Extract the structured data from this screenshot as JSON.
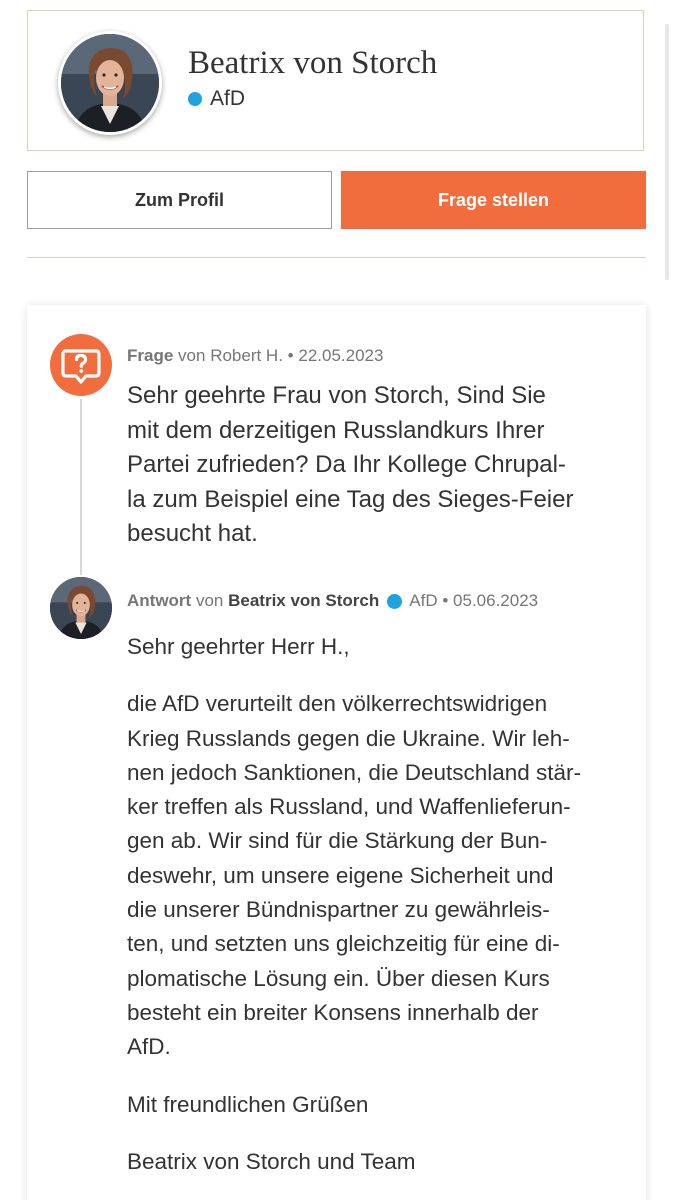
{
  "profile": {
    "name": "Beatrix von Storch",
    "party": "AfD"
  },
  "buttons": {
    "profile_label": "Zum Profil",
    "ask_label": "Frage stellen"
  },
  "question": {
    "label": "Frage",
    "by_word": "von",
    "author": "Robert H.",
    "separator": "•",
    "date": "22.05.2023",
    "lines": [
      "Sehr geehrte Frau von Storch, Sind Sie",
      "mit dem derzeitigen Russlandkurs Ihrer",
      "Partei zufrieden? Da Ihr Kollege Chrupal-",
      "la zum Beispiel eine Tag des Sieges-Feier",
      "besucht hat."
    ]
  },
  "answer": {
    "label": "Antwort",
    "by_word": "von",
    "author": "Beatrix von Storch",
    "party": "AfD",
    "separator": "•",
    "date": "05.06.2023",
    "salutation": "Sehr geehrter Herr H.,",
    "body_lines": [
      "die AfD verurteilt den völkerrechtswidrigen",
      "Krieg Russlands gegen die Ukraine. Wir leh-",
      "nen jedoch Sanktionen, die Deutschland stär-",
      "ker treffen als Russland, und Waffenlieferun-",
      "gen ab. Wir sind für die Stärkung der Bun-",
      "deswehr, um unsere eigene Sicherheit und",
      "die unserer Bündnispartner zu gewährleis-",
      "ten, und setzten uns gleichzeitig für eine di-",
      "plomatische Lösung ein. Über diesen Kurs",
      "besteht ein breiter Konsens innerhalb der",
      "AfD."
    ],
    "closing": "Mit freundlichen Grüßen",
    "signature": "Beatrix von Storch und Team"
  },
  "colors": {
    "accent": "#f26d3d",
    "party_dot": "#1fa3dd",
    "card_border": "#ddd3b8"
  },
  "icons": {
    "question_icon": "speech-bubble-question-icon",
    "party_dot": "party-dot-icon"
  }
}
